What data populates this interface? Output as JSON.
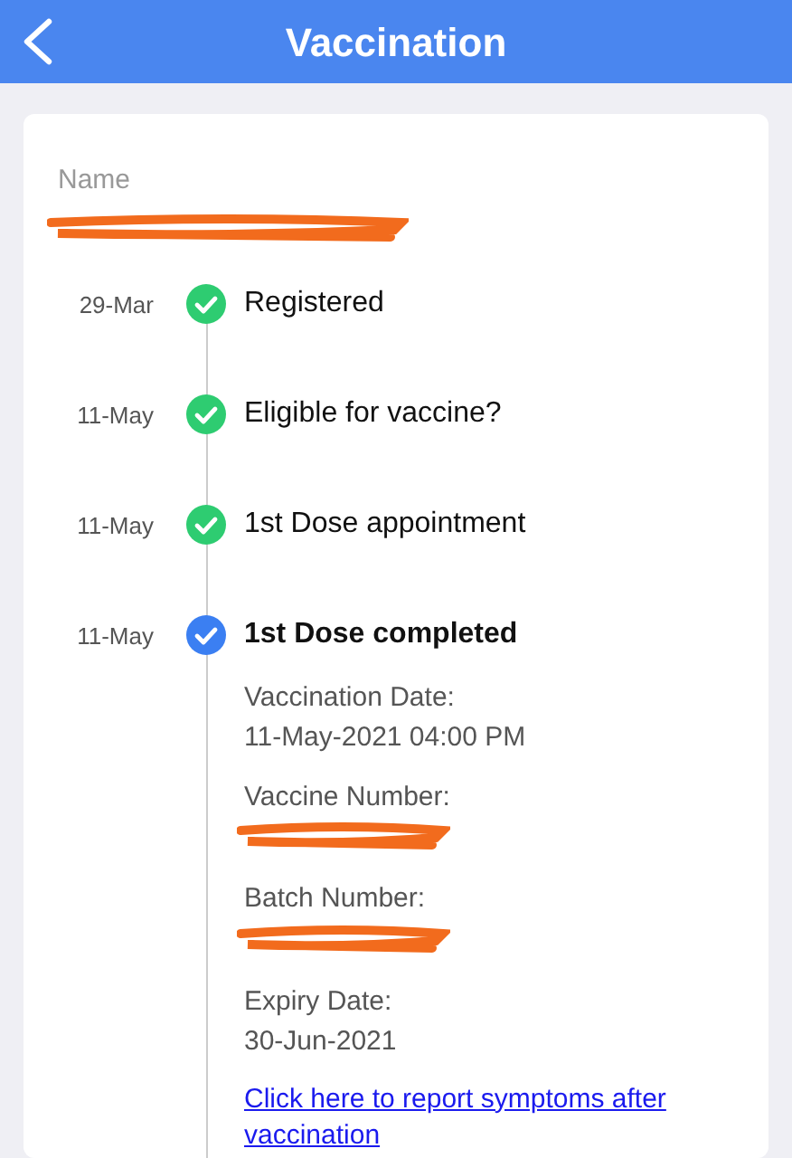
{
  "header": {
    "title": "Vaccination"
  },
  "name_label": "Name",
  "timeline": [
    {
      "date": "29-Mar",
      "label": "Registered",
      "kind": "done"
    },
    {
      "date": "11-May",
      "label": "Eligible for vaccine?",
      "kind": "done"
    },
    {
      "date": "11-May",
      "label": "1st Dose appointment",
      "kind": "done"
    },
    {
      "date": "11-May",
      "label": "1st Dose completed",
      "kind": "current"
    }
  ],
  "details": [
    {
      "label": "Vaccination Date:",
      "value": "11-May-2021 04:00 PM",
      "kind": "text"
    },
    {
      "label": "Vaccine Number:",
      "kind": "redacted"
    },
    {
      "label": "Batch Number:",
      "kind": "redacted"
    },
    {
      "label": "Expiry Date:",
      "value": "30-Jun-2021",
      "kind": "text"
    }
  ],
  "link": "Click here to report symptoms after vaccination"
}
